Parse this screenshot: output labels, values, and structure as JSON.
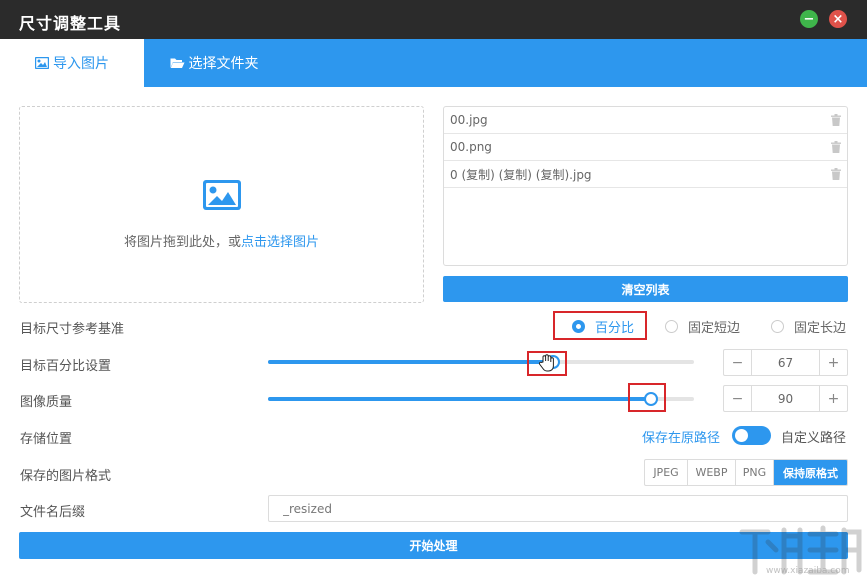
{
  "window": {
    "title": "尺寸调整工具"
  },
  "tabs": [
    {
      "label": "导入图片",
      "active": true
    },
    {
      "label": "选择文件夹",
      "active": false
    }
  ],
  "dropzone": {
    "hint": "将图片拖到此处，或",
    "link": "点击选择图片"
  },
  "files": [
    {
      "name": "00.jpg"
    },
    {
      "name": "00.png"
    },
    {
      "name": "0 (复制) (复制) (复制).jpg"
    }
  ],
  "clear_button": "清空列表",
  "size_basis": {
    "label": "目标尺寸参考基准",
    "options": [
      "百分比",
      "固定短边",
      "固定长边"
    ],
    "selected": "百分比"
  },
  "percent": {
    "label": "目标百分比设置",
    "value": "67",
    "fraction": 0.67
  },
  "quality": {
    "label": "图像质量",
    "value": "90",
    "fraction": 0.9
  },
  "stepper": {
    "minus": "−",
    "plus": "+"
  },
  "storage": {
    "label": "存储位置",
    "left_option": "保存在原路径",
    "right_option": "自定义路径",
    "on": true
  },
  "format": {
    "label": "保存的图片格式",
    "options": [
      "JPEG",
      "WEBP",
      "PNG",
      "保持原格式"
    ],
    "selected": "保持原格式"
  },
  "suffix": {
    "label": "文件名后缀",
    "value": "_resized"
  },
  "start_button": "开始处理",
  "colors": {
    "accent": "#2d97ee",
    "titlebar": "#2b2b2b",
    "highlight": "#d8262a"
  }
}
